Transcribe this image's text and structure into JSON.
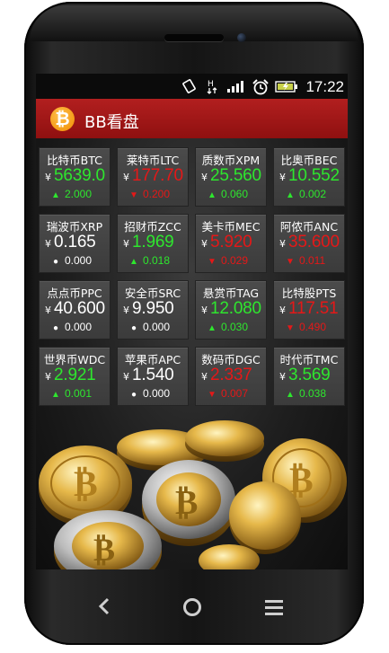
{
  "status_bar": {
    "time": "17:22"
  },
  "app": {
    "title": "BB看盘",
    "logo_glyph": "₿"
  },
  "currency_symbol": "¥",
  "coins": [
    {
      "name": "比特币BTC",
      "price": "5639.0",
      "change": "2.000",
      "direction": "up"
    },
    {
      "name": "莱特币LTC",
      "price": "177.70",
      "change": "0.200",
      "direction": "down"
    },
    {
      "name": "质数币XPM",
      "price": "25.560",
      "change": "0.060",
      "direction": "up"
    },
    {
      "name": "比奥币BEC",
      "price": "10.552",
      "change": "0.002",
      "direction": "up"
    },
    {
      "name": "瑞波币XRP",
      "price": "0.165",
      "change": "0.000",
      "direction": "flat"
    },
    {
      "name": "招财币ZCC",
      "price": "1.969",
      "change": "0.018",
      "direction": "up"
    },
    {
      "name": "美卡币MEC",
      "price": "5.920",
      "change": "0.029",
      "direction": "down"
    },
    {
      "name": "阿侬币ANC",
      "price": "35.600",
      "change": "0.011",
      "direction": "down"
    },
    {
      "name": "点点币PPC",
      "price": "40.600",
      "change": "0.000",
      "direction": "flat"
    },
    {
      "name": "安全币SRC",
      "price": "9.950",
      "change": "0.000",
      "direction": "flat"
    },
    {
      "name": "悬赏币TAG",
      "price": "12.080",
      "change": "0.030",
      "direction": "up"
    },
    {
      "name": "比特股PTS",
      "price": "117.51",
      "change": "0.490",
      "direction": "down"
    },
    {
      "name": "世界币WDC",
      "price": "2.921",
      "change": "0.001",
      "direction": "up"
    },
    {
      "name": "苹果币APC",
      "price": "1.540",
      "change": "0.000",
      "direction": "flat"
    },
    {
      "name": "数码币DGC",
      "price": "2.337",
      "change": "0.007",
      "direction": "down"
    },
    {
      "name": "时代币TMC",
      "price": "3.569",
      "change": "0.038",
      "direction": "up"
    }
  ],
  "colors": {
    "up": "#2ee62e",
    "down": "#e41818",
    "flat": "#ffffff",
    "appbar": "#a01818"
  },
  "icons": {
    "status": [
      "screen-rotate-icon",
      "data-transfer-icon",
      "signal-icon",
      "alarm-icon",
      "battery-icon"
    ],
    "nav": [
      "back-icon",
      "home-icon",
      "menu-icon"
    ]
  }
}
